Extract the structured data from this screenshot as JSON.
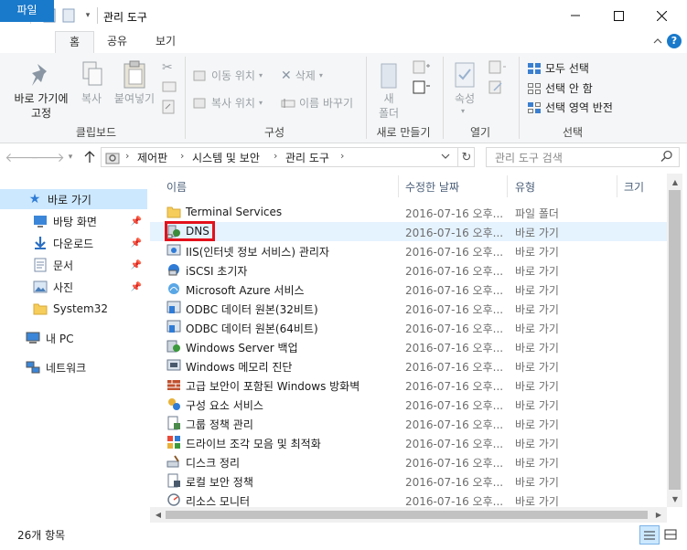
{
  "window": {
    "title": "관리 도구",
    "controls": [
      "minimize",
      "maximize",
      "close"
    ]
  },
  "ribbon_tabs": [
    {
      "label": "파일"
    },
    {
      "label": "홈"
    },
    {
      "label": "공유"
    },
    {
      "label": "보기"
    }
  ],
  "ribbon": {
    "clipboard": {
      "pin_label_1": "바로 가기에",
      "pin_label_2": "고정",
      "copy_label": "복사",
      "paste_label": "붙여넣기",
      "group_label": "클립보드"
    },
    "organize": {
      "move_label": "이동 위치",
      "copy_to_label": "복사 위치",
      "delete_label": "삭제",
      "rename_label": "이름 바꾸기",
      "group_label": "구성"
    },
    "new": {
      "folder_label_1": "새",
      "folder_label_2": "폴더",
      "group_label": "새로 만들기"
    },
    "open": {
      "properties_label": "속성",
      "group_label": "열기"
    },
    "select": {
      "select_all": "모두 선택",
      "select_none": "선택 안 함",
      "invert": "선택 영역 반전",
      "group_label": "선택"
    }
  },
  "address": {
    "crumbs": [
      "제어판",
      "시스템 및 보안",
      "관리 도구"
    ],
    "search_placeholder": "관리 도구 검색"
  },
  "nav_pane": {
    "quick_access": "바로 가기",
    "items": [
      {
        "label": "바탕 화면",
        "icon": "desktop-icon",
        "pinned": true
      },
      {
        "label": "다운로드",
        "icon": "download-icon",
        "pinned": true
      },
      {
        "label": "문서",
        "icon": "document-icon",
        "pinned": true
      },
      {
        "label": "사진",
        "icon": "picture-icon",
        "pinned": true
      },
      {
        "label": "System32",
        "icon": "folder-icon",
        "pinned": false
      }
    ],
    "this_pc": "내 PC",
    "network": "네트워크"
  },
  "columns": {
    "name": "이름",
    "date": "수정한 날짜",
    "type": "유형",
    "size": "크기"
  },
  "files": [
    {
      "name": "Terminal Services",
      "date": "2016-07-16 오후...",
      "type": "파일 폴더",
      "icon": "folder-icon"
    },
    {
      "name": "DNS",
      "date": "2016-07-16 오후...",
      "type": "바로 가기",
      "icon": "dns-icon"
    },
    {
      "name": "IIS(인터넷 정보 서비스) 관리자",
      "date": "2016-07-16 오후...",
      "type": "바로 가기",
      "icon": "iis-icon"
    },
    {
      "name": "iSCSI 초기자",
      "date": "2016-07-16 오후...",
      "type": "바로 가기",
      "icon": "iscsi-icon"
    },
    {
      "name": "Microsoft Azure 서비스",
      "date": "2016-07-16 오후...",
      "type": "바로 가기",
      "icon": "azure-icon"
    },
    {
      "name": "ODBC 데이터 원본(32비트)",
      "date": "2016-07-16 오후...",
      "type": "바로 가기",
      "icon": "odbc-icon"
    },
    {
      "name": "ODBC 데이터 원본(64비트)",
      "date": "2016-07-16 오후...",
      "type": "바로 가기",
      "icon": "odbc-icon"
    },
    {
      "name": "Windows Server 백업",
      "date": "2016-07-16 오후...",
      "type": "바로 가기",
      "icon": "backup-icon"
    },
    {
      "name": "Windows 메모리 진단",
      "date": "2016-07-16 오후...",
      "type": "바로 가기",
      "icon": "memory-icon"
    },
    {
      "name": "고급 보안이 포함된 Windows 방화벽",
      "date": "2016-07-16 오후...",
      "type": "바로 가기",
      "icon": "firewall-icon"
    },
    {
      "name": "구성 요소 서비스",
      "date": "2016-07-16 오후...",
      "type": "바로 가기",
      "icon": "component-icon"
    },
    {
      "name": "그룹 정책 관리",
      "date": "2016-07-16 오후...",
      "type": "바로 가기",
      "icon": "policy-icon"
    },
    {
      "name": "드라이브 조각 모음 및 최적화",
      "date": "2016-07-16 오후...",
      "type": "바로 가기",
      "icon": "defrag-icon"
    },
    {
      "name": "디스크 정리",
      "date": "2016-07-16 오후...",
      "type": "바로 가기",
      "icon": "cleanup-icon"
    },
    {
      "name": "로컬 보안 정책",
      "date": "2016-07-16 오후...",
      "type": "바로 가기",
      "icon": "security-policy-icon"
    },
    {
      "name": "리소스 모니터",
      "date": "2016-07-16 오후...",
      "type": "바로 가기",
      "icon": "monitor-icon"
    }
  ],
  "status": {
    "item_count": "26개 항목"
  },
  "colors": {
    "file_tab": "#1979ca",
    "selection": "#cce8ff",
    "hover_row": "#e5f3ff",
    "highlight_box": "#e3111b"
  }
}
